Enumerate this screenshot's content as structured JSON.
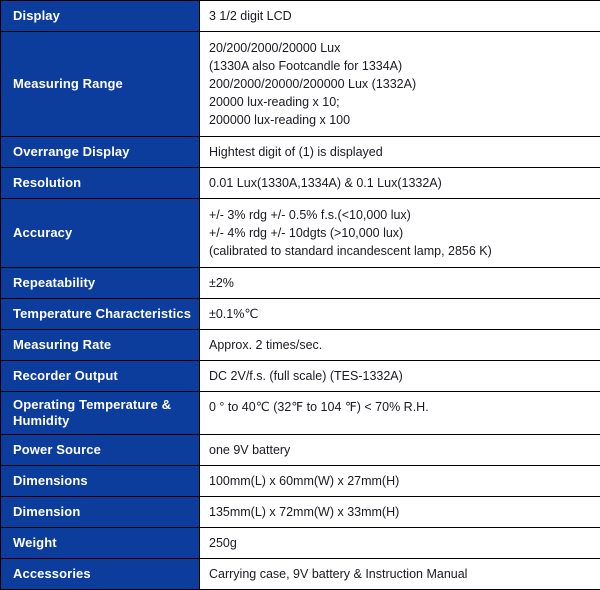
{
  "table": {
    "rows": [
      {
        "label": "Display",
        "lines": [
          "3 1/2 digit LCD"
        ]
      },
      {
        "label": "Measuring Range",
        "lines": [
          "20/200/2000/20000 Lux",
          "(1330A also Footcandle for 1334A)",
          "200/2000/20000/200000 Lux (1332A)",
          "20000 lux-reading x 10;",
          "200000 lux-reading x 100"
        ]
      },
      {
        "label": "Overrange Display",
        "lines": [
          "Hightest digit of (1) is displayed"
        ]
      },
      {
        "label": "Resolution",
        "lines": [
          "0.01 Lux(1330A,1334A) & 0.1 Lux(1332A)"
        ]
      },
      {
        "label": "Accuracy",
        "lines": [
          "+/- 3% rdg +/- 0.5% f.s.(<10,000 lux)",
          "+/- 4% rdg +/- 10dgts (>10,000 lux)",
          "(calibrated to standard incandescent lamp, 2856 K)"
        ]
      },
      {
        "label": "Repeatability",
        "lines": [
          "±2%"
        ]
      },
      {
        "label": "Temperature Characteristics",
        "lines": [
          "±0.1%℃"
        ]
      },
      {
        "label": "Measuring Rate",
        "lines": [
          "Approx. 2 times/sec."
        ]
      },
      {
        "label": "Recorder Output",
        "lines": [
          "DC 2V/f.s. (full scale) (TES-1332A)"
        ]
      },
      {
        "label": "Operating Temperature & Humidity",
        "lines": [
          "0 ° to 40℃ (32℉ to 104 ℉) < 70% R.H."
        ]
      },
      {
        "label": "Power Source",
        "lines": [
          "one 9V battery"
        ]
      },
      {
        "label": "Dimensions",
        "lines": [
          "100mm(L) x 60mm(W) x 27mm(H)"
        ]
      },
      {
        "label": "Dimension",
        "lines": [
          "135mm(L) x 72mm(W) x 33mm(H)"
        ]
      },
      {
        "label": "Weight",
        "lines": [
          "250g"
        ]
      },
      {
        "label": "Accessories",
        "lines": [
          "Carrying case, 9V battery & Instruction Manual"
        ]
      }
    ]
  },
  "colors": {
    "label_background": "#0c3c9c",
    "label_text": "#ffffff",
    "value_background": "#ffffff",
    "value_text": "#1a1a22",
    "border": "#000000"
  }
}
